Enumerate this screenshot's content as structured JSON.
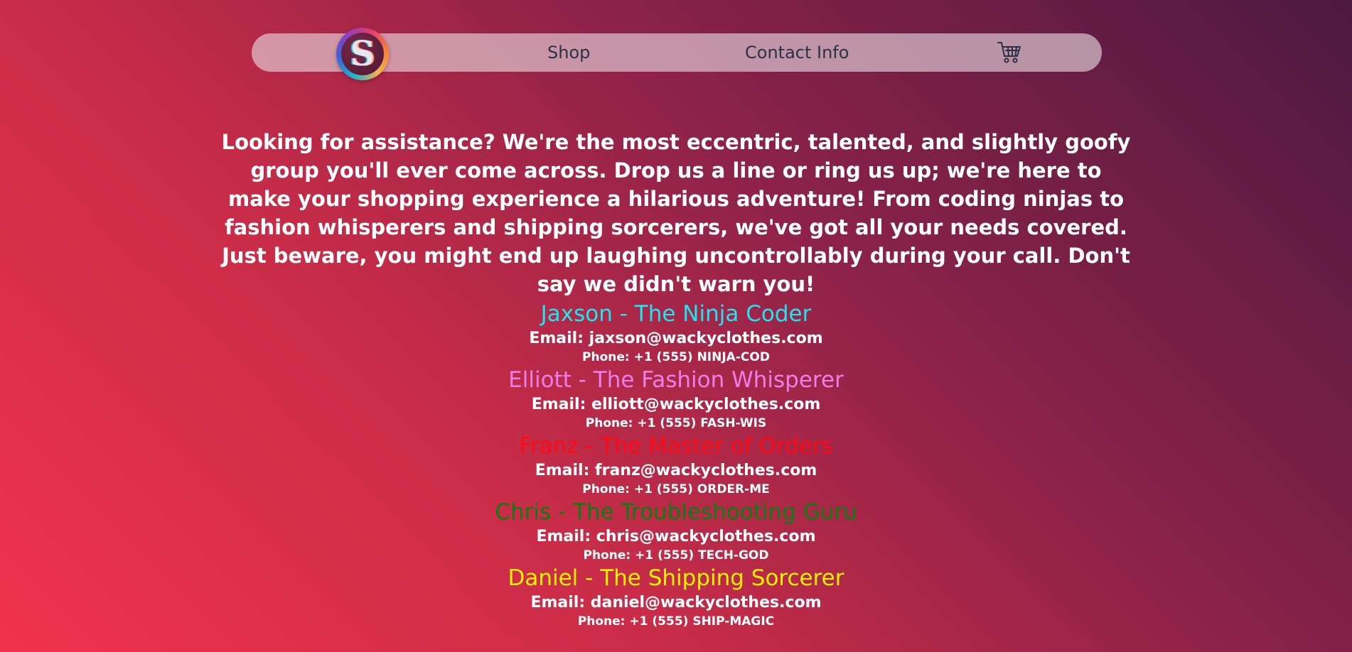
{
  "nav": {
    "logo_icon": "s-logo-icon",
    "shop_label": "Shop",
    "contact_label": "Contact Info",
    "cart_icon": "shopping-cart-icon"
  },
  "intro": {
    "text": "Looking for assistance? We're the most eccentric, talented, and slightly goofy group you'll ever come across. Drop us a line or ring us up; we're here to make your shopping experience a hilarious adventure! From coding ninjas to fashion whisperers and shipping sorcerers, we've got all your needs covered. Just beware, you might end up laughing uncontrollably during your call. Don't say we didn't warn you!"
  },
  "contacts": [
    {
      "name": "Jaxson - The Ninja Coder",
      "email": "Email: jaxson@wackyclothes.com",
      "phone": "Phone: +1 (555) NINJA-COD",
      "color": "#22e3ee"
    },
    {
      "name": "Elliott - The Fashion Whisperer",
      "email": "Email: elliott@wackyclothes.com",
      "phone": "Phone: +1 (555) FASH-WIS",
      "color": "#ef7ee8"
    },
    {
      "name": "Franz - The Master of Orders",
      "email": "Email: franz@wackyclothes.com",
      "phone": "Phone: +1 (555) ORDER-ME",
      "color": "#ff0a14"
    },
    {
      "name": "Chris - The Troubleshooting Guru",
      "email": "Email: chris@wackyclothes.com",
      "phone": "Phone: +1 (555) TECH-GOD",
      "color": "#0b7d12"
    },
    {
      "name": "Daniel - The Shipping Sorcerer",
      "email": "Email: daniel@wackyclothes.com",
      "phone": "Phone: +1 (555) SHIP-MAGIC",
      "color": "#fff200"
    }
  ],
  "theme": {
    "gradient_start": "#f1324c",
    "gradient_end": "#4d1940",
    "nav_text_color": "#2c3147"
  }
}
